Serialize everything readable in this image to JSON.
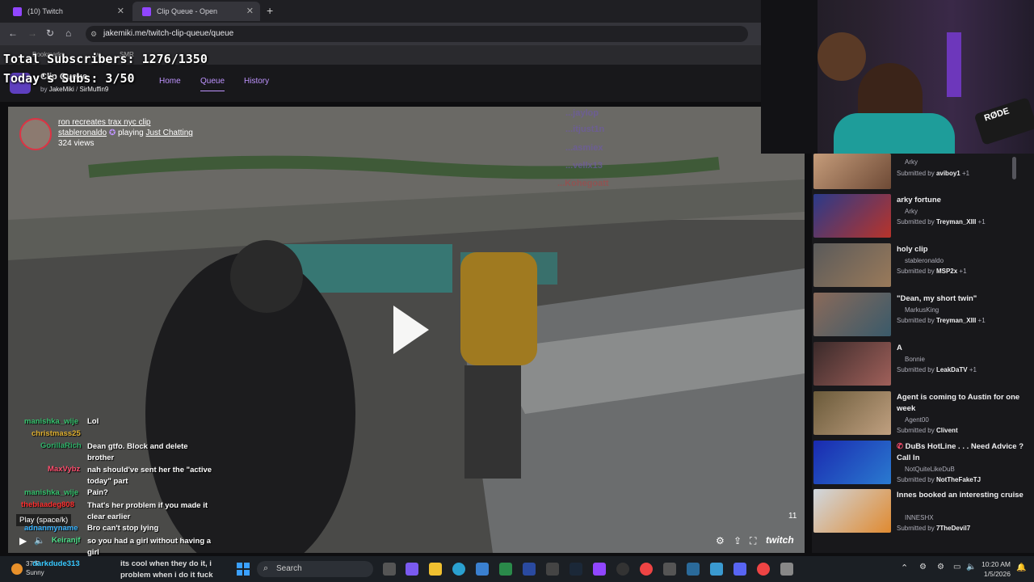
{
  "browser": {
    "tabs": [
      {
        "label": "(10) Twitch"
      },
      {
        "label": "Clip Queue - Open"
      }
    ],
    "new_tab": "+",
    "url": "jakemiki.me/twitch-clip-queue/queue",
    "bookmarks": [
      "Bookmarks",
      "w",
      "SMR"
    ]
  },
  "overlay": {
    "total_subs": "Total Subscribers: 1276/1350",
    "today_subs": "Today's Subs: 3/50"
  },
  "app": {
    "title": "Clip Queue",
    "by": "by",
    "author1": "JakeMiki",
    "author2": "SirMuffin9",
    "nav": [
      "Home",
      "Queue",
      "History"
    ]
  },
  "clip": {
    "title": "ron recreates trax nyc clip",
    "channel": "stableronaldo",
    "playing": "playing",
    "game": "Just Chatting",
    "views": "324 views",
    "counter": "11",
    "tooltip": "Play (space/k)",
    "brand": "twitch"
  },
  "stream_names": [
    "...jaylop",
    "...itjust1n",
    "...asmiex",
    "...vellx13",
    "...Kohegoatt"
  ],
  "chat": [
    {
      "user": "manishka_wije",
      "color": "#36c26e",
      "msg": "Lol"
    },
    {
      "user": "christmass25",
      "color": "#e0b030",
      "msg": ""
    },
    {
      "user": "GorillaRich",
      "color": "#2fb36a",
      "msg": "Dean gtfo. Block and delete brother"
    },
    {
      "user": "MaxVybz",
      "color": "#ff4d6d",
      "msg": "nah should've sent her the \"active today\" part"
    },
    {
      "user": "manishka_wije",
      "color": "#36c26e",
      "msg": "Pain?"
    },
    {
      "user": "thebiaadeg808",
      "color": "#ff3030",
      "msg": "That's her problem if you made it clear earlier"
    },
    {
      "user": "adnanmyname",
      "color": "#37b3ff",
      "msg": "Bro can't stop lying"
    },
    {
      "user": "Keiranjf",
      "color": "#4de08a",
      "msg": "so you had a girl without having a girl"
    },
    {
      "user": "darkdude313",
      "color": "#37c8ff",
      "msg": ""
    }
  ],
  "ticker": [
    "its cool when they do it, i",
    "problem when i do it fuck"
  ],
  "queue": [
    {
      "title": "",
      "channel": "Arky",
      "submitted_by": "aviboy1",
      "extra": "+1"
    },
    {
      "title": "arky fortune",
      "channel": "Arky",
      "submitted_by": "Treyman_XIII",
      "extra": "+1"
    },
    {
      "title": "holy clip",
      "channel": "stableronaldo",
      "submitted_by": "MSP2x",
      "extra": "+1"
    },
    {
      "title": "\"Dean, my short twin\"",
      "channel": "MarkusKing",
      "submitted_by": "Treyman_XIII",
      "extra": "+1"
    },
    {
      "title": "A",
      "channel": "Bonnie",
      "submitted_by": "LeakDaTV",
      "extra": "+1"
    },
    {
      "title": "Agent is coming to Austin for one week",
      "channel": "Agent00",
      "submitted_by": "Clivent",
      "extra": ""
    },
    {
      "title": "DuBs HotLine . . . Need Advice ? Call In",
      "channel": "NotQuiteLikeDuB",
      "submitted_by": "NotTheFakeTJ",
      "extra": ""
    },
    {
      "title": "Innes booked an interesting cruise",
      "channel": "INNESHX",
      "submitted_by": "7TheDevil7",
      "extra": ""
    }
  ],
  "submitted_label": "Submitted by",
  "taskbar": {
    "weather_temp": "37°F",
    "weather_desc": "Sunny",
    "search": "Search",
    "time": "10:20 AM",
    "date": "1/5/2026"
  },
  "webcam_brand": "RØDE"
}
